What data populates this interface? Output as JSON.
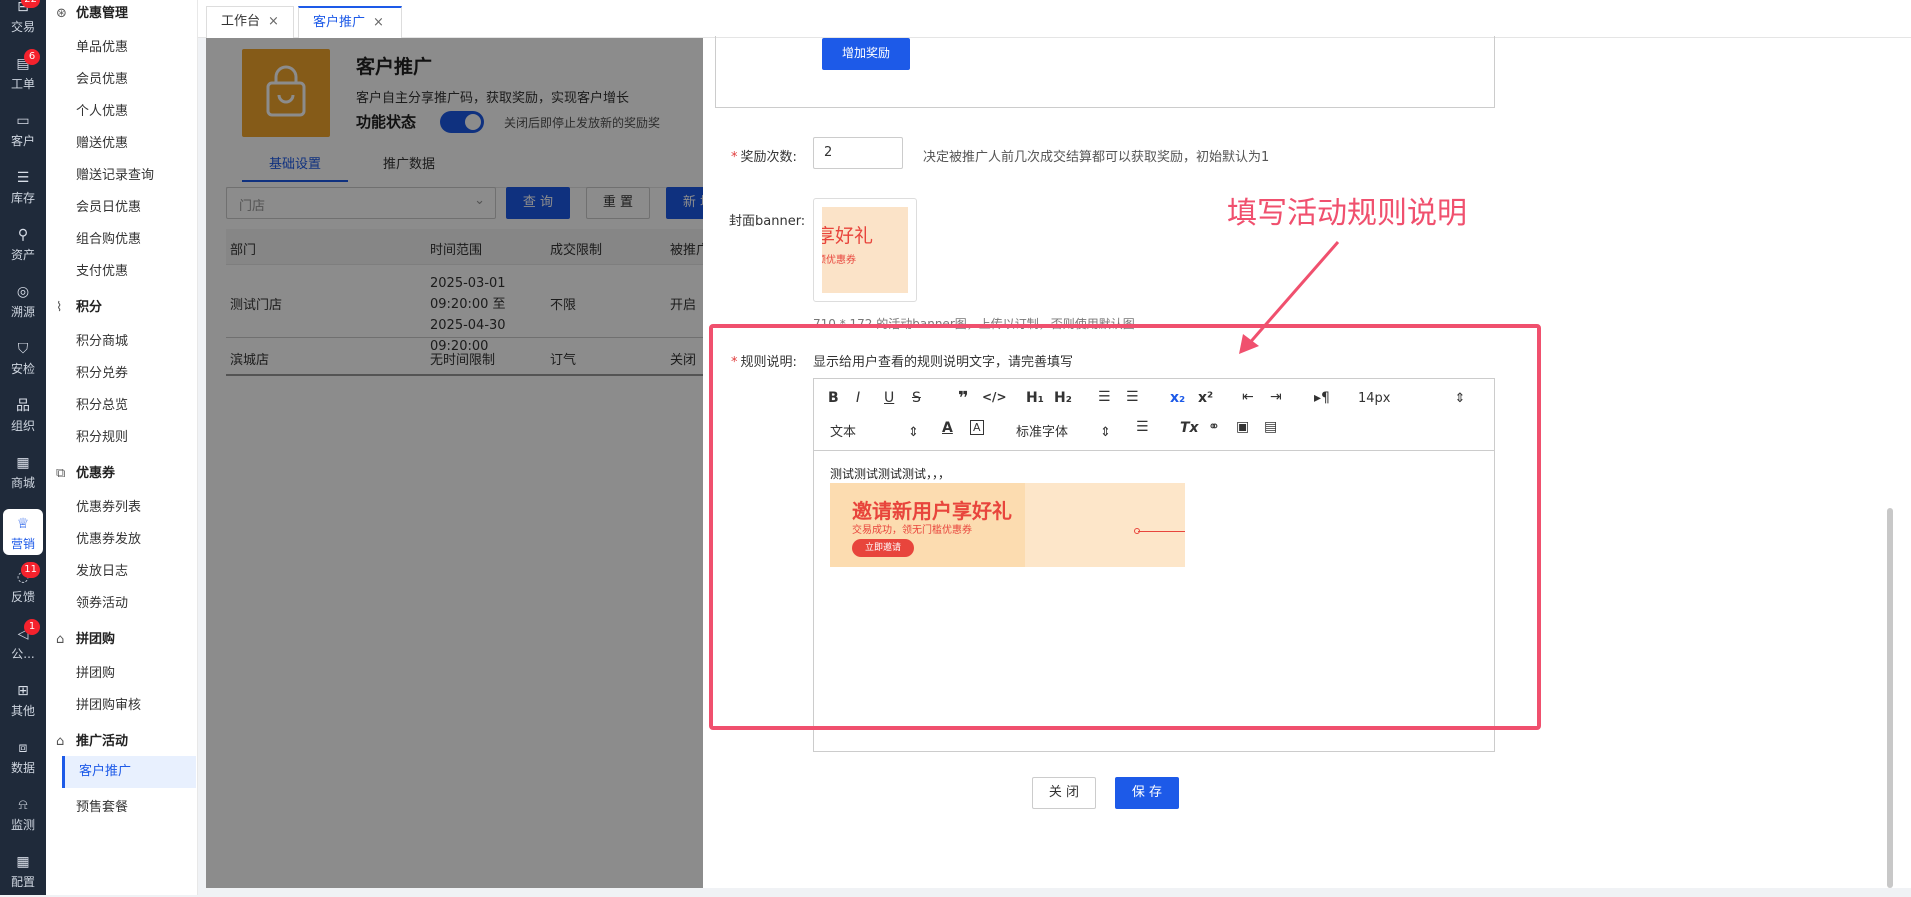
{
  "rail": [
    {
      "label": "交易",
      "icon": "bag-icon",
      "badge": "22"
    },
    {
      "label": "工单",
      "icon": "ticket-icon",
      "badge": "6"
    },
    {
      "label": "客户",
      "icon": "idcard-icon",
      "badge": ""
    },
    {
      "label": "库存",
      "icon": "list-icon",
      "badge": ""
    },
    {
      "label": "资产",
      "icon": "bulb-icon",
      "badge": ""
    },
    {
      "label": "溯源",
      "icon": "compass-icon",
      "badge": ""
    },
    {
      "label": "安检",
      "icon": "shield-icon",
      "badge": ""
    },
    {
      "label": "组织",
      "icon": "org-icon",
      "badge": ""
    },
    {
      "label": "商城",
      "icon": "store-icon",
      "badge": ""
    },
    {
      "label": "营销",
      "icon": "trophy-icon",
      "badge": "",
      "active": true
    },
    {
      "label": "反馈",
      "icon": "chat-icon",
      "badge": "11"
    },
    {
      "label": "公...",
      "icon": "megaphone-icon",
      "badge": "1"
    },
    {
      "label": "其他",
      "icon": "apps-icon",
      "badge": ""
    },
    {
      "label": "数据",
      "icon": "chart-icon",
      "badge": ""
    },
    {
      "label": "监测",
      "icon": "alarm-icon",
      "badge": ""
    },
    {
      "label": "配置",
      "icon": "grid-icon",
      "badge": ""
    }
  ],
  "submenu": {
    "groups": [
      {
        "title": "优惠管理",
        "icon": "coupon-icon",
        "items": [
          "单品优惠",
          "会员优惠",
          "个人优惠",
          "赠送优惠",
          "赠送记录查询",
          "会员日优惠",
          "组合购优惠",
          "支付优惠"
        ]
      },
      {
        "title": "积分",
        "icon": "trend-icon",
        "items": [
          "积分商城",
          "积分兑券",
          "积分总览",
          "积分规则"
        ]
      },
      {
        "title": "优惠券",
        "icon": "voucher-icon",
        "items": [
          "优惠券列表",
          "优惠券发放",
          "发放日志",
          "领券活动"
        ]
      },
      {
        "title": "拼团购",
        "icon": "groupbuy-icon",
        "items": [
          "拼团购",
          "拼团购审核"
        ]
      },
      {
        "title": "推广活动",
        "icon": "promo-icon",
        "items": [
          "客户推广",
          "预售套餐"
        ]
      }
    ],
    "active": "客户推广"
  },
  "tabs": [
    {
      "label": "工作台",
      "active": false
    },
    {
      "label": "客户推广",
      "active": true
    }
  ],
  "header": {
    "title": "客户推广",
    "desc": "客户自主分享推广码，获取奖励，实现客户增长",
    "status_label": "功能状态",
    "status_hint": "关闭后即停止发放新的奖励奖"
  },
  "subtabs": [
    "基础设置",
    "推广数据"
  ],
  "filter": {
    "store_placeholder": "门店",
    "query": "查 询",
    "reset": "重 置",
    "new": "新 增"
  },
  "table": {
    "headers": [
      "部门",
      "时间范围",
      "成交限制",
      "被推广"
    ],
    "rows": [
      [
        "测试门店",
        "2025-03-01 09:20:00 至 2025-04-30 09:20:00",
        "不限",
        "开启"
      ],
      [
        "滨城店",
        "无时间限制",
        "订气",
        "关闭"
      ]
    ]
  },
  "drawer": {
    "add_reward": "增加奖励",
    "reward_times_label": "奖励次数:",
    "reward_times_value": "2",
    "reward_times_hint": "决定被推广人前几次成交结算都可以获取奖励，初始默认为1",
    "banner_label": "封面banner:",
    "banner_thumb_text1": "享好礼",
    "banner_thumb_text2": "领优惠券",
    "banner_hint": "710 * 172 的活动banner图，上传以订制，否则使用默认图",
    "rules_label": "规则说明:",
    "rules_hint": "显示给用户查看的规则说明文字，请完善填写",
    "toolbar": {
      "font_size": "14px",
      "text_style": "文本",
      "font_family": "标准字体"
    },
    "editor_text": "测试测试测试测试，，，",
    "banner_big_title": "邀请新用户享好礼",
    "banner_big_sub": "交易成功，领无门槛优惠券",
    "banner_big_btn": "立即邀请",
    "close": "关 闭",
    "save": "保 存"
  },
  "annotation": {
    "text": "填写活动规则说明",
    "color": "#f0506e"
  }
}
